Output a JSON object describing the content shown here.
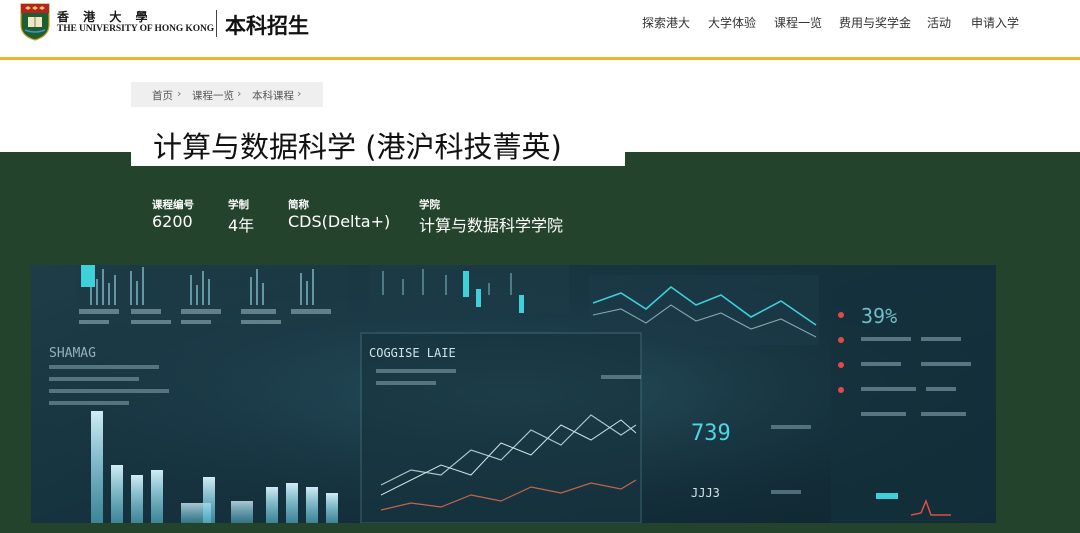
{
  "header": {
    "university_cn": "香 港 大 學",
    "university_en": "THE UNIVERSITY OF HONG KONG",
    "site_title": "本科招生",
    "nav": [
      "探索港大",
      "大学体验",
      "课程一览",
      "费用与奖学金",
      "活动",
      "申请入学"
    ]
  },
  "breadcrumb": [
    "首页",
    "课程一览",
    "本科课程"
  ],
  "page_title": "计算与数据科学 (港沪科技菁英)",
  "meta": [
    {
      "label": "课程编号",
      "value": "6200"
    },
    {
      "label": "学制",
      "value": "4年"
    },
    {
      "label": "简称",
      "value": "CDS(Delta+)"
    },
    {
      "label": "学院",
      "value": "计算与数据科学学院"
    }
  ],
  "banner": {
    "texts": [
      "SHAMAG",
      "COGGISE LAIE",
      "39%",
      "739",
      "JJJ3"
    ]
  },
  "colors": {
    "accent_gold": "#e9b72a",
    "hero_green": "#24432c",
    "chart_cyan": "#3fd0da"
  }
}
